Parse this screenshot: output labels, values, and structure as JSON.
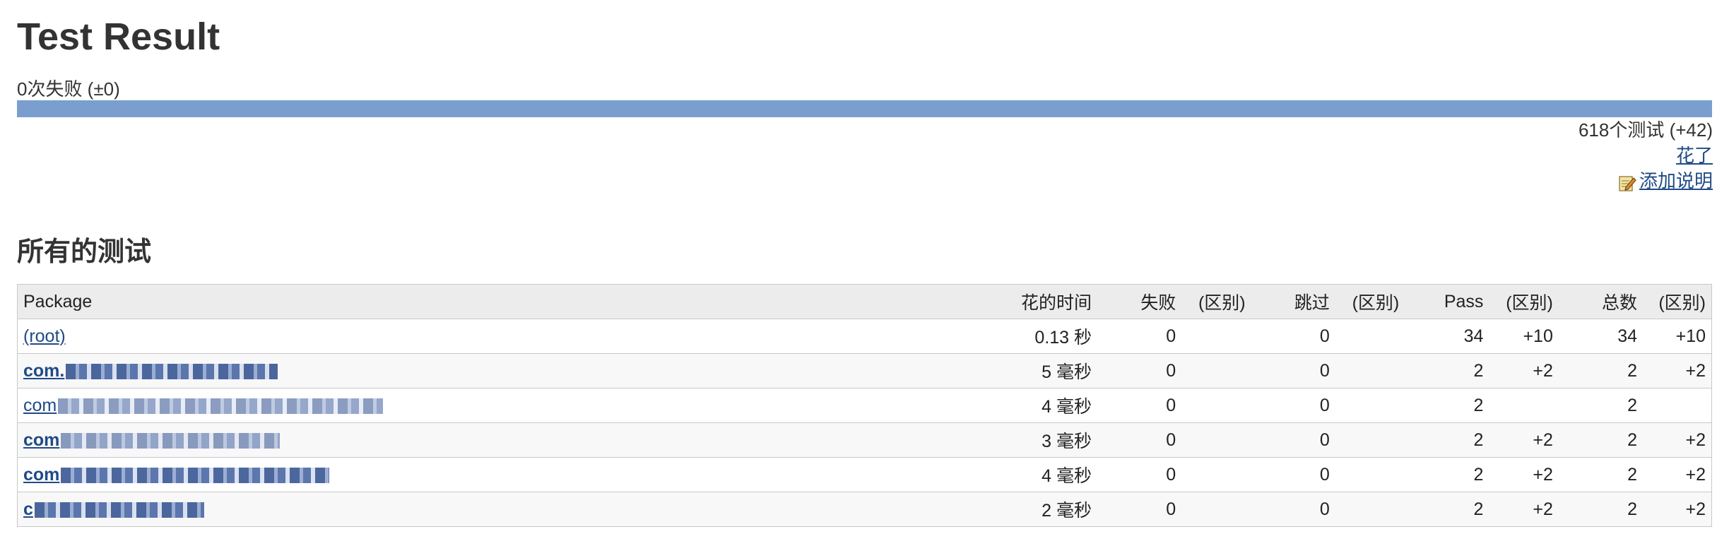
{
  "page": {
    "title": "Test Result",
    "fail_summary": "0次失败 (±0)",
    "progress_pass_fraction": 1.0,
    "test_count": "618个测试 (+42)",
    "took_link": "花了",
    "add_description": "添加说明",
    "icon": "edit-note-icon"
  },
  "section_title": "所有的测试",
  "table": {
    "headers": {
      "package": "Package",
      "duration": "花的时间",
      "fail": "失败",
      "fail_diff": "(区别)",
      "skip": "跳过",
      "skip_diff": "(区别)",
      "pass": "Pass",
      "pass_diff": "(区别)",
      "total": "总数",
      "total_diff": "(区别)"
    },
    "rows": [
      {
        "package": "(root)",
        "duration": "0.13 秒",
        "fail": "0",
        "fail_diff": "",
        "skip": "0",
        "skip_diff": "",
        "pass": "34",
        "pass_diff": "+10",
        "total": "34",
        "total_diff": "+10"
      },
      {
        "package": "com.",
        "duration": "5 毫秒",
        "fail": "0",
        "fail_diff": "",
        "skip": "0",
        "skip_diff": "",
        "pass": "2",
        "pass_diff": "+2",
        "total": "2",
        "total_diff": "+2"
      },
      {
        "package": "com",
        "duration": "4 毫秒",
        "fail": "0",
        "fail_diff": "",
        "skip": "0",
        "skip_diff": "",
        "pass": "2",
        "pass_diff": "",
        "total": "2",
        "total_diff": ""
      },
      {
        "package": "com",
        "duration": "3 毫秒",
        "fail": "0",
        "fail_diff": "",
        "skip": "0",
        "skip_diff": "",
        "pass": "2",
        "pass_diff": "+2",
        "total": "2",
        "total_diff": "+2"
      },
      {
        "package": "com",
        "duration": "4 毫秒",
        "fail": "0",
        "fail_diff": "",
        "skip": "0",
        "skip_diff": "",
        "pass": "2",
        "pass_diff": "+2",
        "total": "2",
        "total_diff": "+2"
      },
      {
        "package": "c",
        "duration": "2 毫秒",
        "fail": "0",
        "fail_diff": "",
        "skip": "0",
        "skip_diff": "",
        "pass": "2",
        "pass_diff": "+2",
        "total": "2",
        "total_diff": "+2"
      }
    ]
  }
}
